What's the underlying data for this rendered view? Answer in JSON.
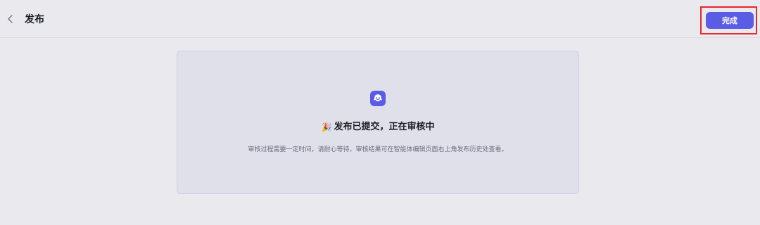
{
  "header": {
    "title": "发布",
    "back_icon": "chevron-left-icon",
    "done_label": "完成"
  },
  "status": {
    "logo_icon": "bot-logo-icon",
    "celebration_icon": "party-popper-icon",
    "celebration_glyph": "🎉",
    "title": "发布已提交，正在审核中",
    "description": "审核过程需要一定时间，请耐心等待，审核结果可在智能体编辑页面右上角发布历史处查看。"
  },
  "colors": {
    "accent": "#5b5ce6",
    "highlight_border": "#e8262b",
    "background": "#e9e9ee",
    "card_background": "#dfe0ea"
  }
}
